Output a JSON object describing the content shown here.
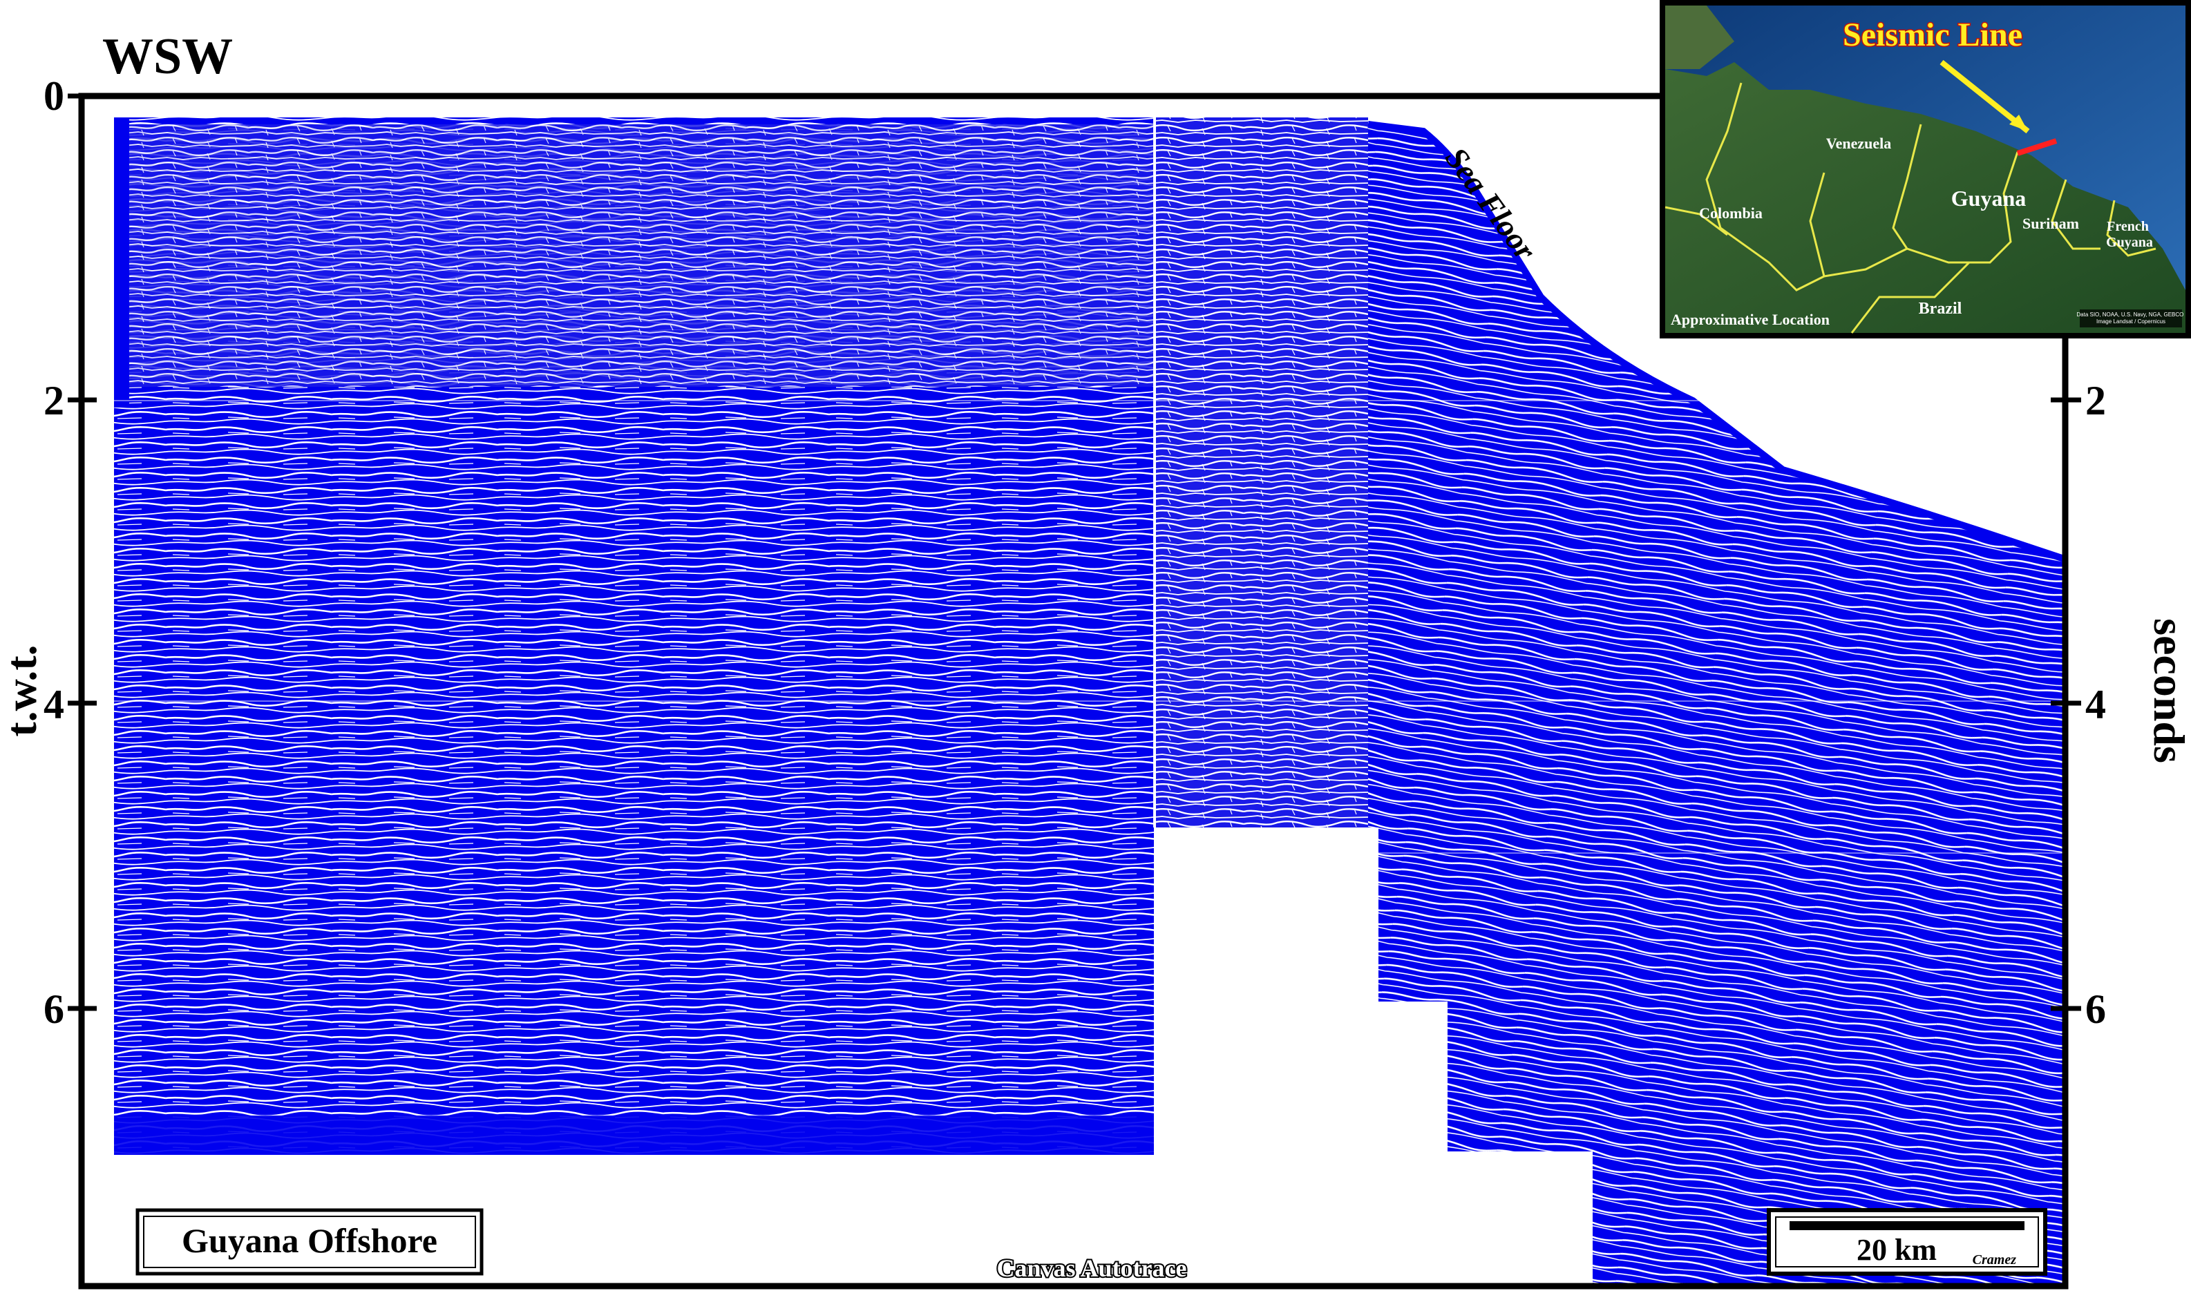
{
  "direction_label": "WSW",
  "axis": {
    "left_title": "t.w.t.",
    "right_title": "seconds",
    "tick_labels": [
      "0",
      "2",
      "4",
      "6"
    ],
    "right_tick_labels": [
      "2",
      "4",
      "6"
    ]
  },
  "annotations": {
    "sea_floor": "Sea Floor",
    "location_box": "Guyana Offshore",
    "watermark": "Canvas Autotrace"
  },
  "scale_bar": {
    "label": "20 km",
    "author": "Cramez"
  },
  "inset_map": {
    "title": "Seismic Line",
    "footer": "Approximative Location",
    "credits": "Data SIO, NOAA, U.S. Navy, NGA, GEBCO\nImage Landsat / Copernicus",
    "countries": [
      "Venezuela",
      "Colombia",
      "Guyana",
      "Surinam",
      "French Guyana",
      "Brazil"
    ]
  },
  "colors": {
    "seismic_fill": "#0000ee",
    "reflector_white": "#ffffff",
    "frame": "#000000",
    "map_title": "#ffee22",
    "map_border_line": "#e8e84a",
    "seismic_line_marker": "#ff2020"
  }
}
